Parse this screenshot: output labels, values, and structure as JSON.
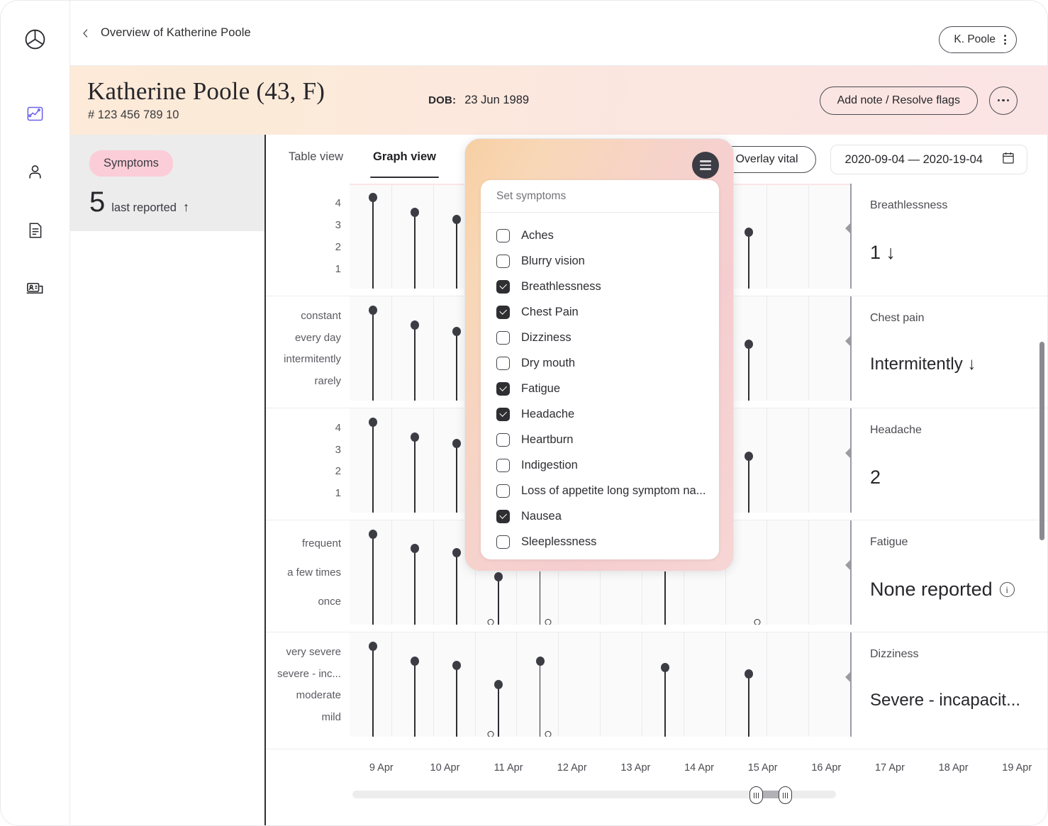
{
  "sidebar": {
    "logo_icon": "brand-logo-icon",
    "items": [
      {
        "icon": "chart-trend-icon",
        "name": "analytics",
        "active": true
      },
      {
        "icon": "person-icon",
        "name": "patients",
        "active": false
      },
      {
        "icon": "document-icon",
        "name": "records",
        "active": false
      },
      {
        "icon": "id-card-laptop-icon",
        "name": "consultations",
        "active": false
      }
    ]
  },
  "topbar": {
    "back_icon": "chevron-left-icon",
    "breadcrumb": "Overview of Katherine Poole",
    "user_pill": {
      "label": "K. Poole",
      "icon": "kebab-vertical-icon"
    }
  },
  "patient_header": {
    "name": "Katherine Poole (43,  F)",
    "patient_id": "# 123 456 789 10",
    "dob_label": "DOB:",
    "dob_value": "23 Jun 1989",
    "primary_action": "Add note / Resolve flags",
    "more_icon": "ellipsis-horizontal-icon"
  },
  "summary_panel": {
    "pill_label": "Symptoms",
    "count": "5",
    "count_caption": "last reported",
    "trend_arrow": "↑",
    "pill_color": "#fbcdd8"
  },
  "main": {
    "tabs": [
      {
        "label": "Table view",
        "active": false
      },
      {
        "label": "Graph view",
        "active": true
      }
    ],
    "overlay_button": "Overlay vital",
    "date_range": "2020-09-04 — 2020-19-04",
    "calendar_icon": "calendar-icon"
  },
  "popup": {
    "title": "Set symptoms",
    "menu_icon": "hamburger-menu-icon",
    "options": [
      {
        "label": "Aches",
        "checked": false
      },
      {
        "label": "Blurry vision",
        "checked": false
      },
      {
        "label": "Breathlessness",
        "checked": true
      },
      {
        "label": "Chest Pain",
        "checked": true
      },
      {
        "label": "Dizziness",
        "checked": false
      },
      {
        "label": "Dry mouth",
        "checked": false
      },
      {
        "label": "Fatigue",
        "checked": true
      },
      {
        "label": "Headache",
        "checked": true
      },
      {
        "label": "Heartburn",
        "checked": false
      },
      {
        "label": "Indigestion",
        "checked": false
      },
      {
        "label": "Loss of appetite long symptom na...",
        "checked": false
      },
      {
        "label": "Nausea",
        "checked": true
      },
      {
        "label": "Sleeplessness",
        "checked": false
      }
    ]
  },
  "chart_data": {
    "type": "scatter",
    "title": "Symptom severity over time",
    "xlabel": "",
    "ylabel": "",
    "grid": true,
    "legend": "none",
    "x": [
      "9 Apr",
      "10 Apr",
      "11 Apr",
      "12 Apr",
      "13 Apr",
      "14 Apr",
      "15 Apr",
      "16 Apr",
      "17 Apr",
      "18 Apr",
      "19 Apr"
    ],
    "series": [
      {
        "name": "Breathlessness",
        "ytick_labels": [
          "4",
          "3",
          "2",
          "1"
        ],
        "ylim": [
          0,
          4
        ],
        "summary_label": "Breathlessness",
        "summary_value": "1 ↓",
        "points": [
          {
            "x": "9 Apr",
            "y": 4
          },
          {
            "x": "10 Apr",
            "y": 3.3
          },
          {
            "x": "11 Apr",
            "y": 3.0
          },
          {
            "x": "12 Apr",
            "y": 2.2
          },
          {
            "x": "13 Apr",
            "y": 3.6
          },
          {
            "x": "16 Apr",
            "y": 3.5
          },
          {
            "x": "18 Apr",
            "y": 2.4
          }
        ]
      },
      {
        "name": "Chest pain",
        "ytick_labels": [
          "constant",
          "every day",
          "intermitently",
          "rarely"
        ],
        "ylim": [
          0,
          4
        ],
        "summary_label": "Chest pain",
        "summary_value": "Intermitently ↓",
        "points": [
          {
            "x": "9 Apr",
            "y": 4
          },
          {
            "x": "10 Apr",
            "y": 3.3
          },
          {
            "x": "11 Apr",
            "y": 3.0
          },
          {
            "x": "12 Apr",
            "y": 2.2
          },
          {
            "x": "13 Apr",
            "y": 3.6
          },
          {
            "x": "16 Apr",
            "y": 3.5
          },
          {
            "x": "18 Apr",
            "y": 2.4
          }
        ]
      },
      {
        "name": "Headache",
        "ytick_labels": [
          "4",
          "3",
          "2",
          "1"
        ],
        "ylim": [
          0,
          4
        ],
        "summary_label": "Headache",
        "summary_value": "2",
        "points": [
          {
            "x": "9 Apr",
            "y": 4
          },
          {
            "x": "10 Apr",
            "y": 3.3
          },
          {
            "x": "11 Apr",
            "y": 3.0
          },
          {
            "x": "12 Apr",
            "y": 2.2
          },
          {
            "x": "13 Apr",
            "y": 3.6
          },
          {
            "x": "16 Apr",
            "y": 3.5
          },
          {
            "x": "18 Apr",
            "y": 2.4
          }
        ]
      },
      {
        "name": "Fatigue",
        "ytick_labels": [
          "frequent",
          "a few times",
          "once"
        ],
        "ylim": [
          0,
          3
        ],
        "summary_label": "Fatigue",
        "summary_value": "None reported",
        "summary_icon": "info-icon",
        "points": [
          {
            "x": "9 Apr",
            "y": 3
          },
          {
            "x": "10 Apr",
            "y": 2.5
          },
          {
            "x": "11 Apr",
            "y": 2.35
          },
          {
            "x": "12 Apr",
            "y": 0,
            "zero": true
          },
          {
            "x": "12 Apr",
            "y": 1.5
          },
          {
            "x": "13 Apr",
            "y": 0,
            "zero": true
          },
          {
            "x": "13 Apr",
            "y": 2.8
          },
          {
            "x": "16 Apr",
            "y": 2.8
          },
          {
            "x": "18 Apr",
            "y": 0,
            "zero": true
          }
        ]
      },
      {
        "name": "Dizziness",
        "ytick_labels": [
          "very severe",
          "severe - inc...",
          "moderate",
          "mild"
        ],
        "ylim": [
          0,
          4
        ],
        "summary_label": "Dizziness",
        "summary_value": "Severe - incapacit...",
        "points": [
          {
            "x": "9 Apr",
            "y": 4
          },
          {
            "x": "10 Apr",
            "y": 3.3
          },
          {
            "x": "11 Apr",
            "y": 3.1
          },
          {
            "x": "12 Apr",
            "y": 0,
            "zero": true
          },
          {
            "x": "12 Apr",
            "y": 2.2
          },
          {
            "x": "13 Apr",
            "y": 0,
            "zero": true
          },
          {
            "x": "13 Apr",
            "y": 3.3
          },
          {
            "x": "16 Apr",
            "y": 3.0
          },
          {
            "x": "18 Apr",
            "y": 2.7
          }
        ]
      }
    ]
  },
  "timeline": {
    "ticks": [
      "9 Apr",
      "10 Apr",
      "11 Apr",
      "12 Apr",
      "13 Apr",
      "14 Apr",
      "15 Apr",
      "16 Apr",
      "17 Apr",
      "18 Apr",
      "19 Apr"
    ],
    "scrubber": {
      "left_handle_icon": "grip-handle-icon",
      "right_handle_icon": "grip-handle-icon"
    }
  }
}
